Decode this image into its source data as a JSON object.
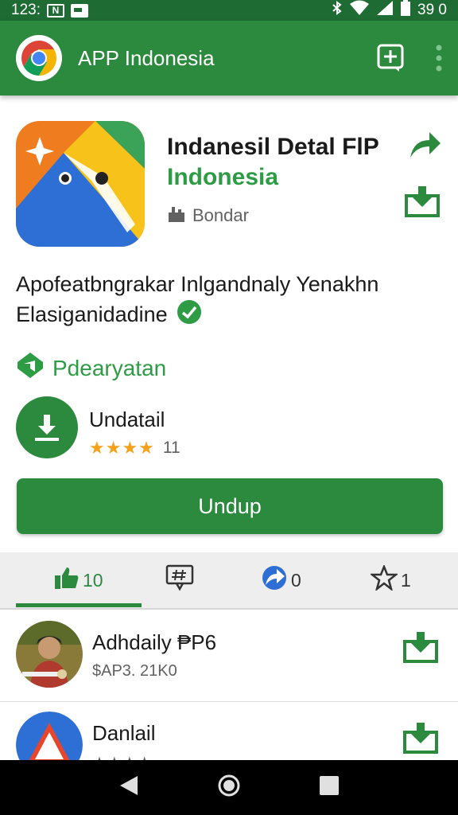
{
  "status_bar": {
    "time": "123:",
    "badge": "N",
    "battery": "39 0"
  },
  "app_bar": {
    "title": "APP Indonesia"
  },
  "app": {
    "title": "Indanesil Detal FlP",
    "subtitle": "Indonesia",
    "developer": "Bondar",
    "icon_colors": {
      "orange": "#ef7d1f",
      "green": "#3aa357",
      "yellow": "#f7c31b",
      "blue": "#2e6fd6"
    }
  },
  "description": {
    "line1": "Apofeatbngrakar Inlgandnaly Yenakhn",
    "line2": "Elasiganidadine"
  },
  "section": {
    "title": "Pdearyatan"
  },
  "download": {
    "label": "Undatail",
    "stars": "★★★★",
    "rating_count": "11"
  },
  "main_button": {
    "label": "Undup"
  },
  "stats": {
    "likes": "10",
    "shares": "0",
    "favorites": "1"
  },
  "list": [
    {
      "title": "Adhdaily ₱P6",
      "subtitle": "$AP3. 21K0"
    },
    {
      "title": "Danlail",
      "subtitle": "★★★★"
    }
  ],
  "colors": {
    "brand_green": "#2b8a3e",
    "status_green": "#1e6b34",
    "accent_green": "#2e9b45",
    "star": "#f4a21c"
  }
}
